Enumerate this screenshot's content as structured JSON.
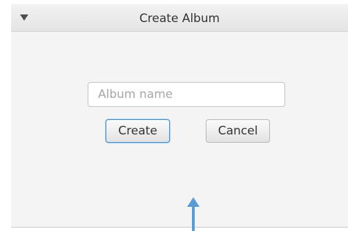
{
  "dialog": {
    "title": "Create Album",
    "collapse_icon": "triangle-down-icon"
  },
  "form": {
    "album_name": {
      "value": "",
      "placeholder": "Album name"
    },
    "create_label": "Create",
    "cancel_label": "Cancel"
  },
  "colors": {
    "dialog_background": "#f4f4f4",
    "focus_accent": "#3c8fcf",
    "pointer_arrow": "#5b9bd5"
  },
  "annotation": {
    "pointer_icon": "up-arrow-icon"
  }
}
